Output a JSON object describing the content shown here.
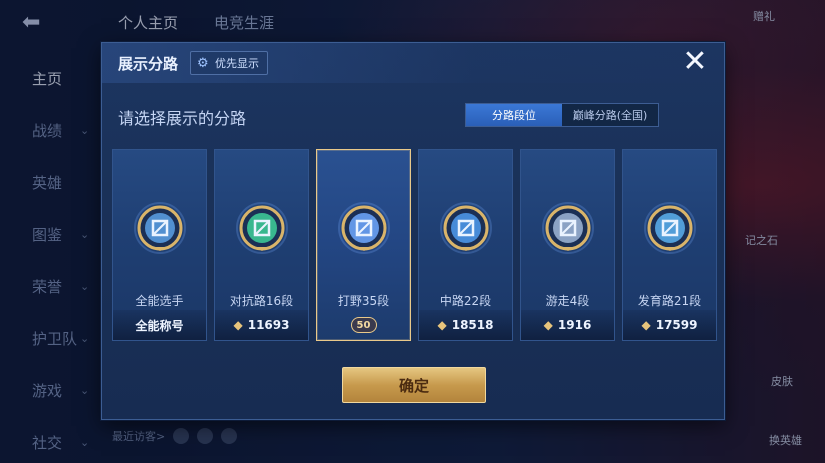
{
  "background": {
    "tabs": [
      "个人主页",
      "电竞生涯"
    ],
    "nav": [
      {
        "label": "主页",
        "active": true
      },
      {
        "label": "战绩",
        "active": false
      },
      {
        "label": "英雄",
        "active": false
      },
      {
        "label": "图鉴",
        "active": false
      },
      {
        "label": "荣誉",
        "active": false
      },
      {
        "label": "护卫队",
        "active": false
      },
      {
        "label": "游戏",
        "active": false
      },
      {
        "label": "社交",
        "active": false
      }
    ],
    "recent_visitors": "最近访客>",
    "right_labels": [
      "赠礼",
      "记之石",
      "皮肤",
      "换英雄"
    ]
  },
  "modal": {
    "title": "展示分路",
    "priority_button": "优先显示",
    "close_icon": "close-icon",
    "subtitle": "请选择展示的分路",
    "toggle": [
      {
        "label": "分路段位",
        "active": true
      },
      {
        "label": "巅峰分路(全国)",
        "active": false
      }
    ],
    "cards": [
      {
        "name": "全能选手",
        "footer": "全能称号",
        "show_diamond": false,
        "selected": false,
        "icon": "all-round-badge-icon",
        "color": "#5aa0e6"
      },
      {
        "name": "对抗路16段",
        "footer": "11693",
        "show_diamond": true,
        "selected": false,
        "icon": "clash-lane-badge-icon",
        "color": "#3ecf9a"
      },
      {
        "name": "打野35段",
        "footer": "50",
        "show_diamond": false,
        "selected": true,
        "icon": "jungle-badge-icon",
        "color": "#6fa8ff"
      },
      {
        "name": "中路22段",
        "footer": "18518",
        "show_diamond": true,
        "selected": false,
        "icon": "mid-lane-badge-icon",
        "color": "#4f9bf0"
      },
      {
        "name": "游走4段",
        "footer": "1916",
        "show_diamond": true,
        "selected": false,
        "icon": "roam-badge-icon",
        "color": "#9fb6d8"
      },
      {
        "name": "发育路21段",
        "footer": "17599",
        "show_diamond": true,
        "selected": false,
        "icon": "farm-lane-badge-icon",
        "color": "#5ab0f0"
      }
    ],
    "confirm": "确定"
  }
}
